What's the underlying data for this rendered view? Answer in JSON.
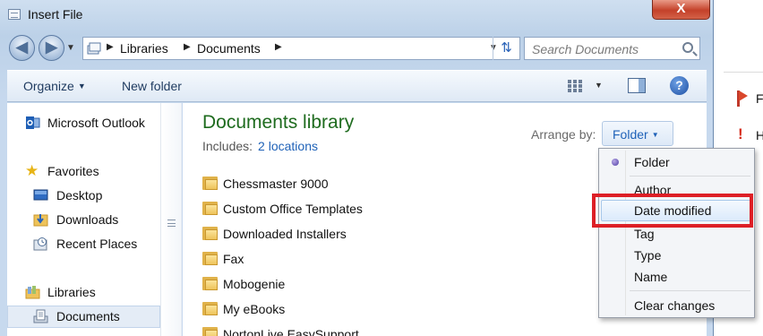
{
  "window": {
    "title": "Insert File",
    "close_label": "X"
  },
  "address": {
    "crumbs": [
      "Libraries",
      "Documents"
    ],
    "search_placeholder": "Search Documents"
  },
  "toolbar": {
    "organize_label": "Organize",
    "new_folder_label": "New folder",
    "help_label": "?"
  },
  "sidebar": {
    "items": [
      {
        "label": "Microsoft Outlook",
        "icon": "outlook-icon"
      },
      {
        "label": "Favorites",
        "icon": "star-icon"
      },
      {
        "label": "Desktop",
        "icon": "desktop-icon"
      },
      {
        "label": "Downloads",
        "icon": "downloads-folder-icon"
      },
      {
        "label": "Recent Places",
        "icon": "recent-places-icon"
      },
      {
        "label": "Libraries",
        "icon": "libraries-icon"
      },
      {
        "label": "Documents",
        "icon": "documents-icon"
      }
    ]
  },
  "content": {
    "title": "Documents library",
    "includes_label": "Includes:",
    "includes_link": "2 locations",
    "arrange_label": "Arrange by:",
    "arrange_value": "Folder",
    "folders": [
      "Chessmaster 9000",
      "Custom Office Templates",
      "Downloaded Installers",
      "Fax",
      "Mobogenie",
      "My eBooks",
      "NortonLive EasySupport"
    ]
  },
  "arrange_menu": {
    "items": [
      "Folder",
      "Author",
      "Date modified",
      "Tag",
      "Type",
      "Name",
      "Clear changes"
    ],
    "selected": "Folder",
    "hovered": "Date modified"
  },
  "background_app": {
    "line1": "F",
    "line2": "H"
  },
  "colors": {
    "highlight_box": "#dd1f26",
    "library_title": "#1e6b1e",
    "link": "#1f62b8"
  }
}
